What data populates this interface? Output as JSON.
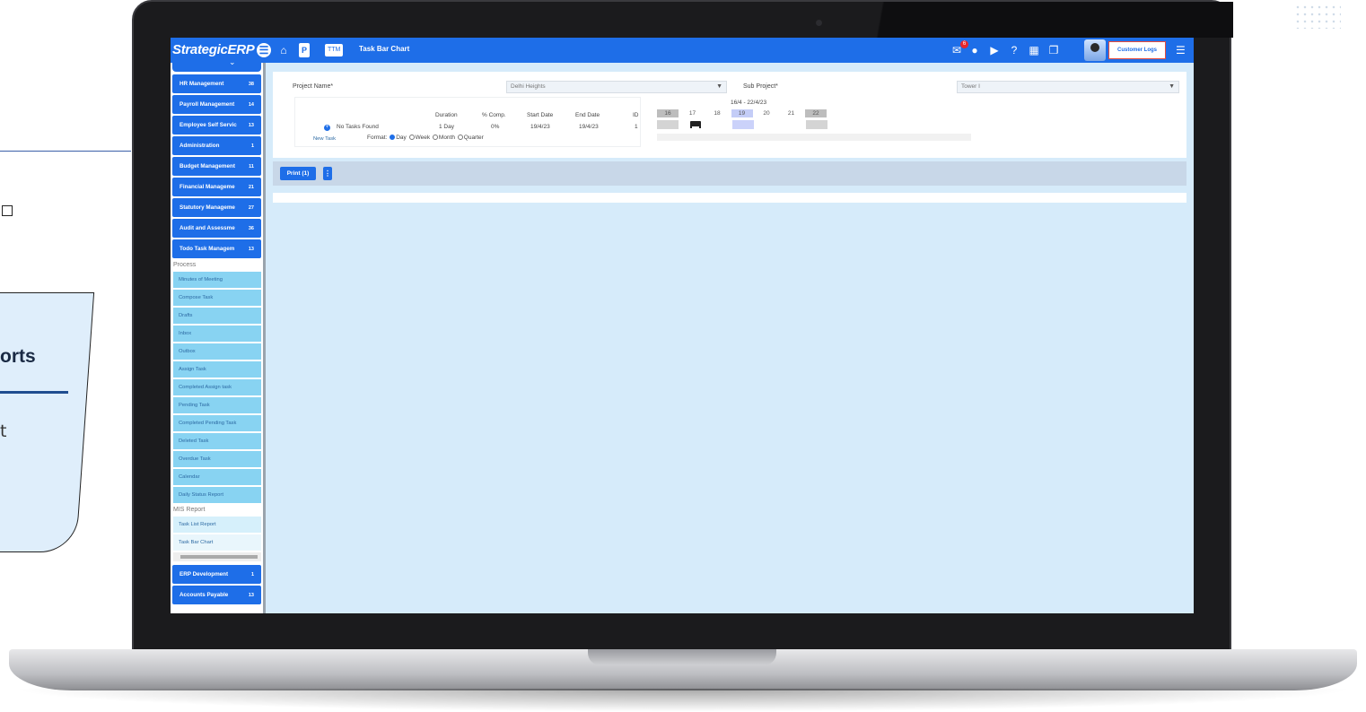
{
  "background": {
    "card_title": "orts",
    "card_text": "t"
  },
  "app": {
    "logo_main": "Strategic",
    "logo_brand": "ERP",
    "ttm_label": "TTM",
    "p_label": "P",
    "page_title": "Task Bar Chart",
    "mail_badge": "6",
    "customer_button": "Customer Logs"
  },
  "sidebar": {
    "modules_top": [
      {
        "label": "HR Management",
        "count": "38"
      },
      {
        "label": "Payroll Management",
        "count": "14"
      },
      {
        "label": "Employee Self Servic",
        "count": "13"
      },
      {
        "label": "Administration",
        "count": "1"
      },
      {
        "label": "Budget Management",
        "count": "11"
      },
      {
        "label": "Financial Manageme",
        "count": "21"
      },
      {
        "label": "Statutory Manageme",
        "count": "27"
      },
      {
        "label": "Audit and Assessme",
        "count": "36"
      },
      {
        "label": "Todo Task Managem",
        "count": "13"
      }
    ],
    "process_label": "Process",
    "process_items": [
      "Minutes of Meeting",
      "Compose Task",
      "Drafts",
      "Inbox",
      "Outbox",
      "Assign Task",
      "Completed Assign task",
      "Pending Task",
      "Completed Pending Task",
      "Deleted Task",
      "Overdue Task",
      "Calendar",
      "Daily Status Report"
    ],
    "mis_label": "MIS Report",
    "mis_items": [
      "Task List Report",
      "Task Bar Chart"
    ],
    "modules_bottom": [
      {
        "label": "ERP Development",
        "count": "1"
      },
      {
        "label": "Accounts Payable",
        "count": "13"
      }
    ]
  },
  "filters": {
    "project_label": "Project Name*",
    "project_value": "Delhi Heights",
    "subproject_label": "Sub Project*",
    "subproject_value": "Tower I"
  },
  "gantt": {
    "headers": {
      "duration": "Duration",
      "comp": "% Comp.",
      "start": "Start Date",
      "end": "End Date",
      "id": "ID"
    },
    "row": {
      "name": "No Tasks Found",
      "duration": "1 Day",
      "comp": "0%",
      "start": "19/4/23",
      "end": "19/4/23",
      "id": "1"
    },
    "new_task": "New Task",
    "format_label": "Format:",
    "formats": [
      "Day",
      "Week",
      "Month",
      "Quarter"
    ],
    "selected_format": "Day",
    "week_range": "16/4 - 22/4/23",
    "days": [
      "16",
      "17",
      "18",
      "19",
      "20",
      "21",
      "22"
    ]
  },
  "toolbar": {
    "print_label": "Print (1)",
    "more_label": "⋮"
  }
}
